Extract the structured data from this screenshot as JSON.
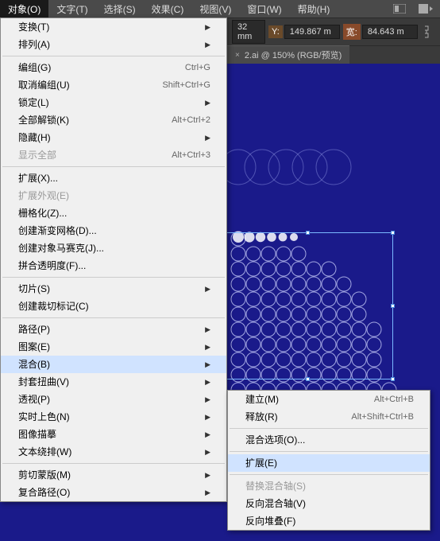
{
  "menubar": {
    "items": [
      "对象(O)",
      "文字(T)",
      "选择(S)",
      "效果(C)",
      "视图(V)",
      "窗口(W)",
      "帮助(H)"
    ],
    "active_index": 0
  },
  "toolbar": {
    "x_suffix": "32 mm",
    "y_label": "Y:",
    "y_value": "149.867 m",
    "w_label": "宽:",
    "w_value": "84.643 m"
  },
  "tabs": {
    "active": {
      "label": "2.ai @ 150% (RGB/预览)",
      "close": "×"
    }
  },
  "main_menu": {
    "groups": [
      [
        {
          "label": "变换(T)",
          "arrow": true
        },
        {
          "label": "排列(A)",
          "arrow": true
        }
      ],
      [
        {
          "label": "编组(G)",
          "shortcut": "Ctrl+G"
        },
        {
          "label": "取消编组(U)",
          "shortcut": "Shift+Ctrl+G"
        },
        {
          "label": "锁定(L)",
          "arrow": true
        },
        {
          "label": "全部解锁(K)",
          "shortcut": "Alt+Ctrl+2"
        },
        {
          "label": "隐藏(H)",
          "arrow": true
        },
        {
          "label": "显示全部",
          "shortcut": "Alt+Ctrl+3",
          "disabled": true
        }
      ],
      [
        {
          "label": "扩展(X)..."
        },
        {
          "label": "扩展外观(E)",
          "disabled": true
        },
        {
          "label": "栅格化(Z)..."
        },
        {
          "label": "创建渐变网格(D)..."
        },
        {
          "label": "创建对象马赛克(J)..."
        },
        {
          "label": "拼合透明度(F)..."
        }
      ],
      [
        {
          "label": "切片(S)",
          "arrow": true
        },
        {
          "label": "创建裁切标记(C)"
        }
      ],
      [
        {
          "label": "路径(P)",
          "arrow": true
        },
        {
          "label": "图案(E)",
          "arrow": true
        },
        {
          "label": "混合(B)",
          "arrow": true,
          "hover": true
        },
        {
          "label": "封套扭曲(V)",
          "arrow": true
        },
        {
          "label": "透视(P)",
          "arrow": true
        },
        {
          "label": "实时上色(N)",
          "arrow": true
        },
        {
          "label": "图像描摹",
          "arrow": true
        },
        {
          "label": "文本绕排(W)",
          "arrow": true
        }
      ],
      [
        {
          "label": "剪切蒙版(M)",
          "arrow": true
        },
        {
          "label": "复合路径(O)",
          "arrow": true
        }
      ]
    ]
  },
  "sub_menu": {
    "groups": [
      [
        {
          "label": "建立(M)",
          "shortcut": "Alt+Ctrl+B"
        },
        {
          "label": "释放(R)",
          "shortcut": "Alt+Shift+Ctrl+B"
        }
      ],
      [
        {
          "label": "混合选项(O)..."
        }
      ],
      [
        {
          "label": "扩展(E)",
          "hover": true
        }
      ],
      [
        {
          "label": "替换混合轴(S)",
          "disabled": true
        },
        {
          "label": "反向混合轴(V)"
        },
        {
          "label": "反向堆叠(F)"
        }
      ]
    ]
  }
}
